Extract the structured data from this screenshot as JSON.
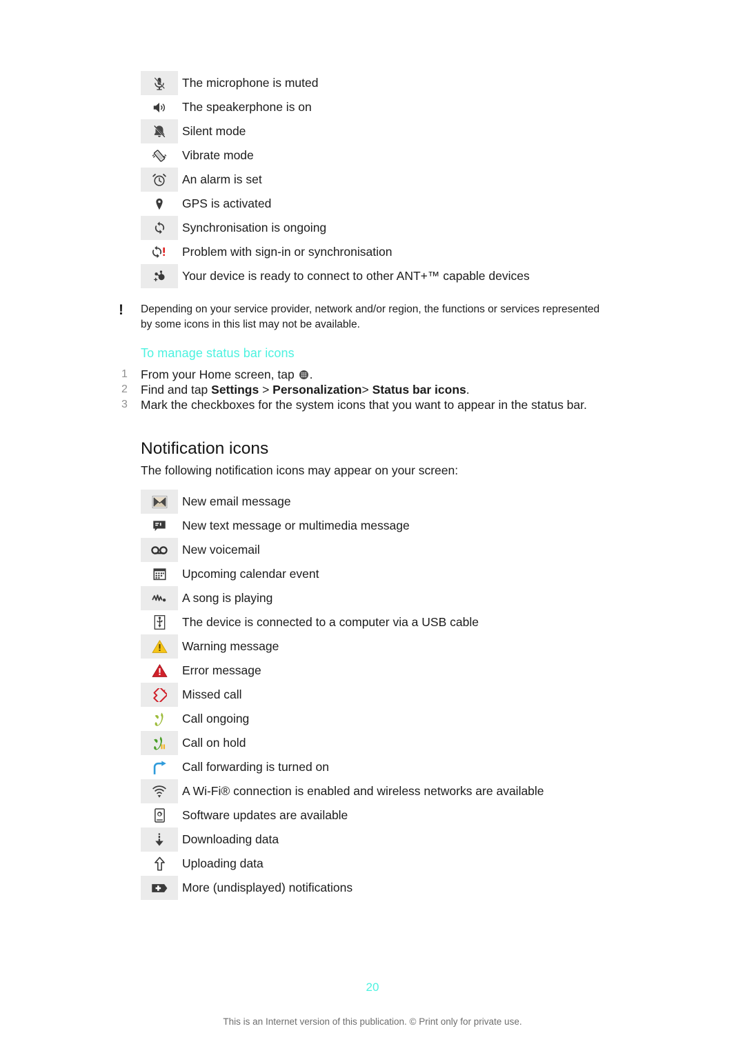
{
  "document": {
    "page_number": "20",
    "footer_note": "This is an Internet version of this publication. © Print only for private use."
  },
  "status_bar_icons": {
    "rows": [
      {
        "icon": "microphone-muted-icon",
        "label": "The microphone is muted"
      },
      {
        "icon": "speakerphone-on-icon",
        "label": "The speakerphone is on"
      },
      {
        "icon": "silent-mode-icon",
        "label": "Silent mode"
      },
      {
        "icon": "vibrate-mode-icon",
        "label": "Vibrate mode"
      },
      {
        "icon": "alarm-clock-icon",
        "label": "An alarm is set"
      },
      {
        "icon": "gps-pin-icon",
        "label": "GPS is activated"
      },
      {
        "icon": "sync-ongoing-icon",
        "label": "Synchronisation is ongoing"
      },
      {
        "icon": "sync-problem-icon",
        "label": "Problem with sign-in or synchronisation"
      },
      {
        "icon": "ant-plus-icon",
        "label": "Your device is ready to connect  to other ANT+™ capable devices"
      }
    ]
  },
  "note": {
    "bang": "!",
    "text": "Depending on your service provider, network and/or region, the functions or services represented by some icons in this list may not be available."
  },
  "manage_section": {
    "heading": "To manage status bar icons",
    "steps": [
      {
        "number": "1",
        "parts": [
          {
            "type": "text",
            "value": "From your Home screen, tap "
          },
          {
            "type": "icon",
            "value": "app-drawer-icon"
          },
          {
            "type": "text",
            "value": "."
          }
        ]
      },
      {
        "number": "2",
        "parts": [
          {
            "type": "text",
            "value": "Find and tap "
          },
          {
            "type": "bold",
            "value": "Settings"
          },
          {
            "type": "text",
            "value": " > "
          },
          {
            "type": "bold",
            "value": "Personalization"
          },
          {
            "type": "text",
            "value": "> "
          },
          {
            "type": "bold",
            "value": "Status bar icons"
          },
          {
            "type": "text",
            "value": "."
          }
        ]
      },
      {
        "number": "3",
        "parts": [
          {
            "type": "text",
            "value": "Mark the checkboxes for the system icons that you want to appear in the status bar."
          }
        ]
      }
    ]
  },
  "notification_section": {
    "heading": "Notification icons",
    "intro": "The following notification icons may appear on your screen:",
    "rows": [
      {
        "icon": "email-message-icon",
        "label": "New email message"
      },
      {
        "icon": "text-message-icon",
        "label": "New text message or multimedia message"
      },
      {
        "icon": "voicemail-icon",
        "label": "New voicemail"
      },
      {
        "icon": "calendar-event-icon",
        "label": "Upcoming calendar event"
      },
      {
        "icon": "music-playing-icon",
        "label": "A song is playing"
      },
      {
        "icon": "usb-connected-icon",
        "label": "The device is connected to a computer via a USB cable"
      },
      {
        "icon": "warning-icon",
        "label": "Warning message"
      },
      {
        "icon": "error-icon",
        "label": "Error message"
      },
      {
        "icon": "missed-call-icon",
        "label": "Missed call"
      },
      {
        "icon": "call-ongoing-icon",
        "label": "Call ongoing"
      },
      {
        "icon": "call-on-hold-icon",
        "label": "Call on hold"
      },
      {
        "icon": "call-forwarding-icon",
        "label": "Call forwarding is turned on"
      },
      {
        "icon": "wifi-available-icon",
        "label": "A Wi-Fi® connection is enabled and wireless networks are available"
      },
      {
        "icon": "software-update-icon",
        "label": "Software updates are available"
      },
      {
        "icon": "downloading-icon",
        "label": "Downloading data"
      },
      {
        "icon": "uploading-icon",
        "label": "Uploading data"
      },
      {
        "icon": "more-notifications-icon",
        "label": "More (undisplayed) notifications"
      }
    ]
  },
  "colors": {
    "accent_cyan": "#4df2e0",
    "stripe_grey": "#ebebeb",
    "warning_yellow": "#f5c518",
    "error_red": "#d0202a",
    "call_green": "#4a9e28",
    "forward_blue": "#2f9bdb",
    "icon_dark": "#3a3a3a"
  }
}
